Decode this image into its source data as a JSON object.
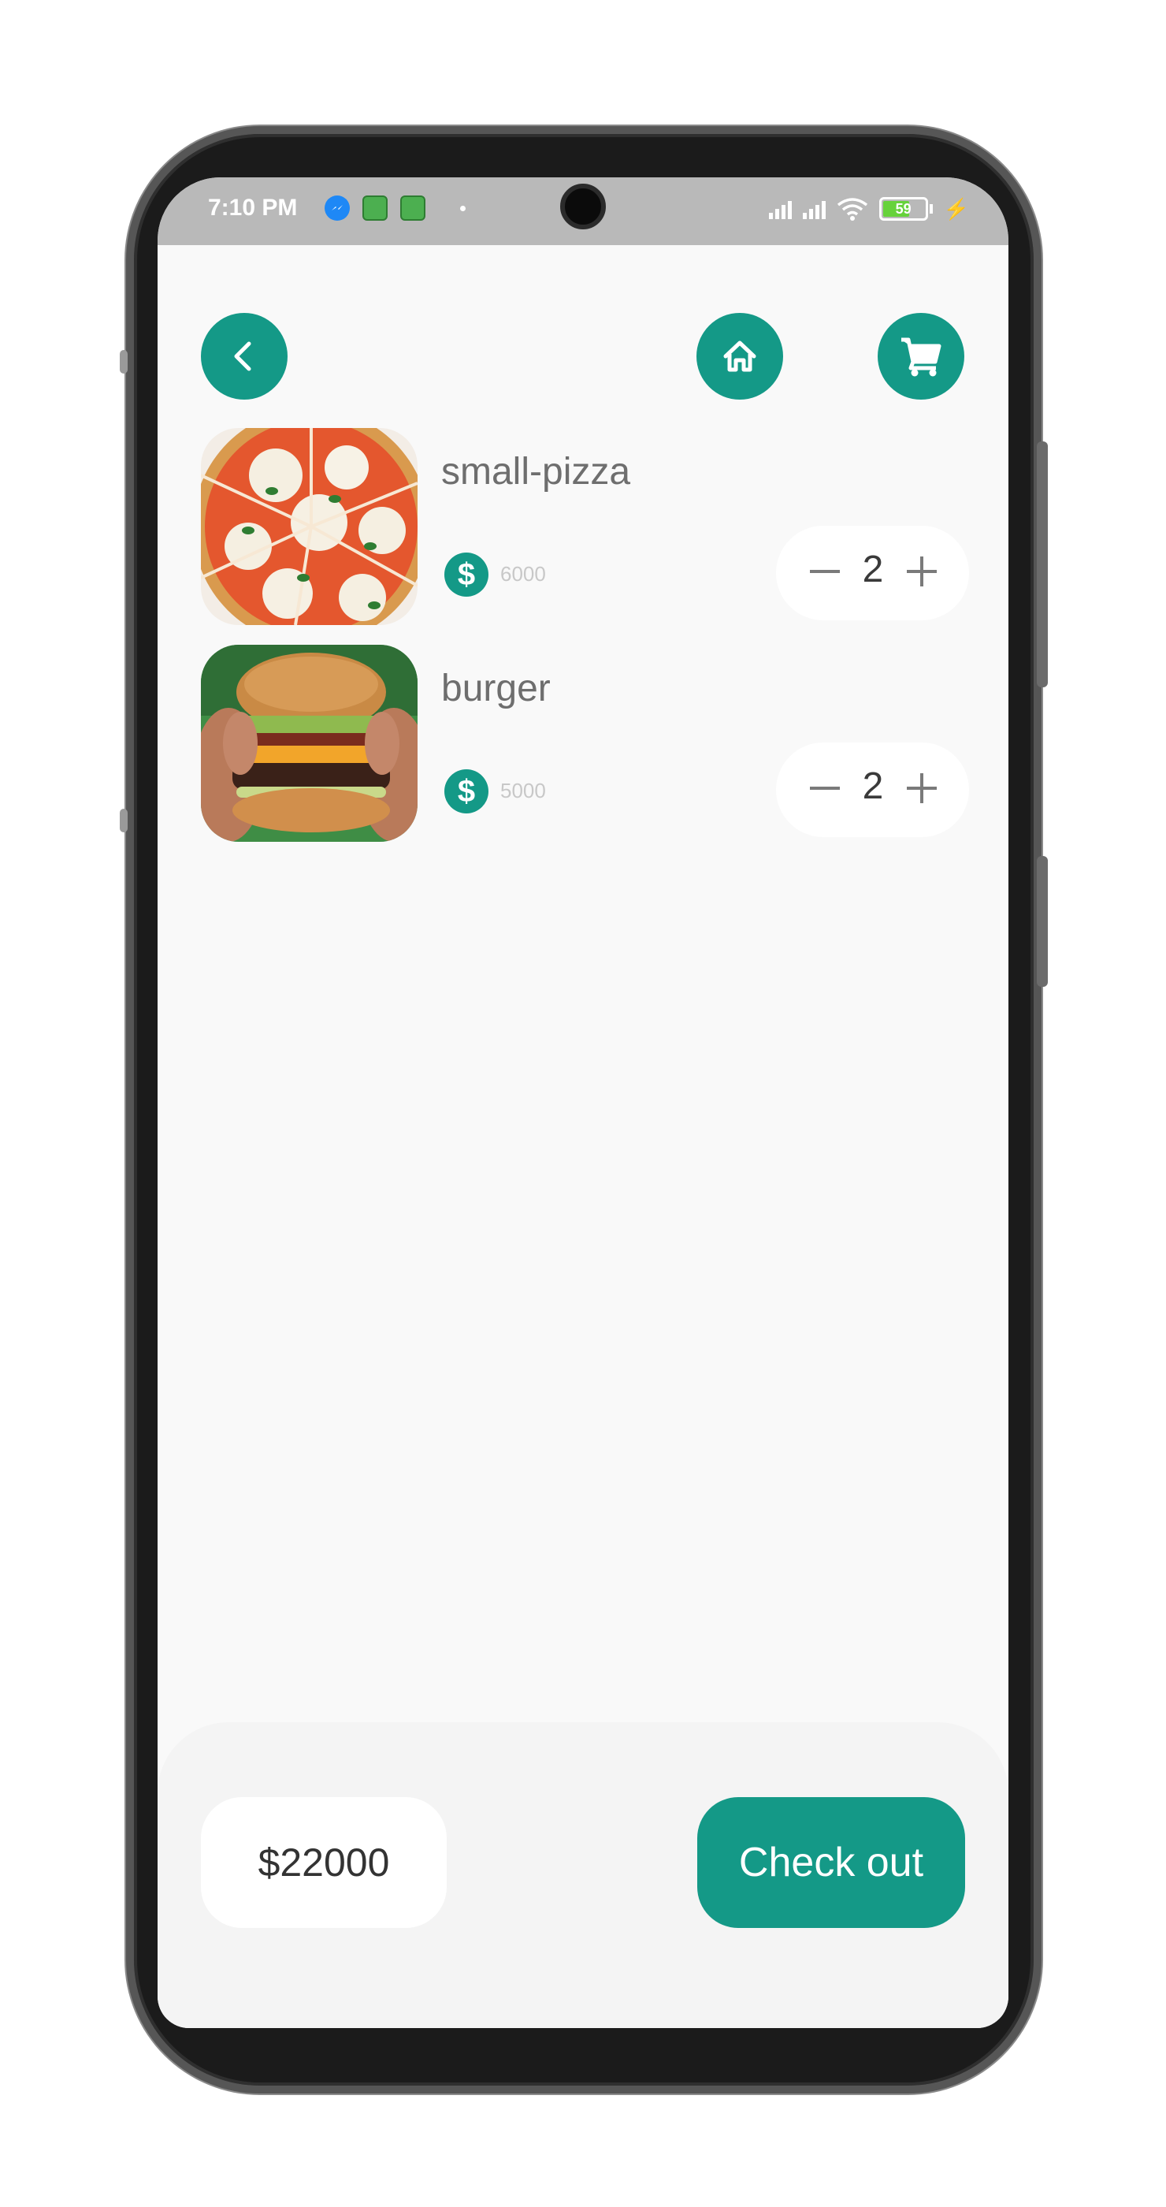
{
  "status_bar": {
    "time": "7:10 PM",
    "battery_level": "59",
    "icons": [
      "messenger-icon",
      "app-icon",
      "app-icon",
      "signal-icon",
      "signal-icon",
      "wifi-icon",
      "battery-icon",
      "charging-icon"
    ]
  },
  "header": {
    "back_icon": "chevron-left-icon",
    "home_icon": "home-icon",
    "cart_icon": "cart-icon"
  },
  "cart": {
    "items": [
      {
        "name": "small-pizza",
        "price": "6000",
        "quantity": "2"
      },
      {
        "name": "burger",
        "price": "5000",
        "quantity": "2"
      }
    ]
  },
  "footer": {
    "total": "$22000",
    "checkout_label": "Check out"
  },
  "colors": {
    "accent": "#149987",
    "background": "#f9f9f9",
    "status_bar": "#b9b9b9"
  }
}
